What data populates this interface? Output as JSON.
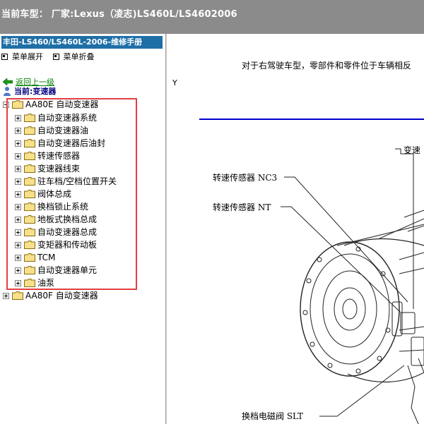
{
  "header": {
    "title": "当前车型：  厂家:Lexus（凌志)LS460L/LS4602006"
  },
  "left_panel": {
    "manual_title": "丰田-LS460/LS460L-2006-维修手册",
    "menu_expand": "菜单展开",
    "menu_collapse": "菜单折叠",
    "back_link": "返回上一级",
    "current_label": "当前:变速器",
    "tree": {
      "root1": "AA80E 自动变速器",
      "children": [
        "自动变速器系统",
        "自动变速器油",
        "自动变速器后油封",
        "转速传感器",
        "变速器线束",
        "驻车档/空档位置开关",
        "阀体总成",
        "换档锁止系统",
        "地板式换档总成",
        "自动变速器总成",
        "变矩器和传动板",
        "TCM",
        "自动变速器单元",
        "油泵"
      ],
      "root2": "AA80F 自动变速器"
    },
    "highlight_color": "#e04040"
  },
  "document": {
    "intro_text": "对于右驾驶车型，零部件和零件位于车辆相反",
    "y_label": "Y",
    "callouts": {
      "speed_sensor_nc3": "转速传感器 NC3",
      "speed_sensor_nt": "转速传感器 NT",
      "transmission_partial": "变速",
      "shift_solenoid_slt": "换档电磁阀 SLT"
    },
    "rule_color": "#0000cc"
  }
}
